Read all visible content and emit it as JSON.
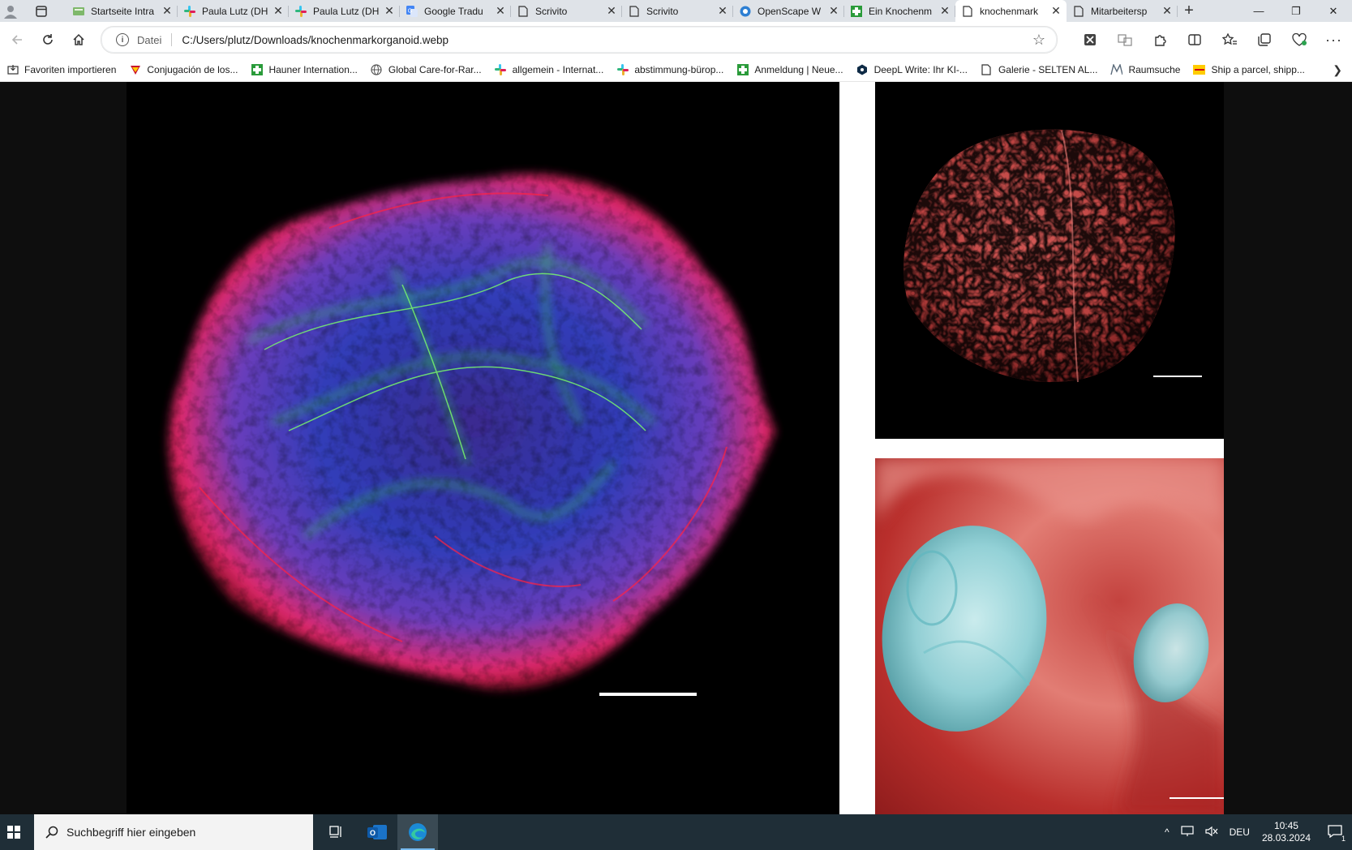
{
  "browser": {
    "tabs": [
      {
        "title": "Startseite Intra",
        "icon": "intranet-icon",
        "active": false
      },
      {
        "title": "Paula Lutz (DH",
        "icon": "slack-icon",
        "active": false
      },
      {
        "title": "Paula Lutz (DH",
        "icon": "slack-icon",
        "active": false
      },
      {
        "title": "Google Tradu",
        "icon": "google-translate-icon",
        "active": false
      },
      {
        "title": "Scrivito",
        "icon": "page-icon",
        "active": false
      },
      {
        "title": "Scrivito",
        "icon": "page-icon",
        "active": false
      },
      {
        "title": "OpenScape W",
        "icon": "openscape-icon",
        "active": false
      },
      {
        "title": "Ein Knochenm",
        "icon": "green-cross-icon",
        "active": false
      },
      {
        "title": "knochenmark",
        "icon": "page-icon",
        "active": true
      },
      {
        "title": "Mitarbeitersp",
        "icon": "page-icon",
        "active": false
      }
    ],
    "address": {
      "scheme_label": "Datei",
      "url": "C:/Users/plutz/Downloads/knochenmarkorganoid.webp"
    },
    "favorites": [
      {
        "label": "Favoriten importieren",
        "icon": "import-icon"
      },
      {
        "label": "Conjugación de los...",
        "icon": "flag-icon"
      },
      {
        "label": "Hauner Internation...",
        "icon": "green-cross-icon"
      },
      {
        "label": "Global Care-for-Rar...",
        "icon": "globe-icon"
      },
      {
        "label": "allgemein - Internat...",
        "icon": "slack-icon"
      },
      {
        "label": "abstimmung-bürop...",
        "icon": "slack-icon"
      },
      {
        "label": "Anmeldung | Neue...",
        "icon": "green-cross-icon"
      },
      {
        "label": "DeepL Write: Ihr KI-...",
        "icon": "deepl-icon"
      },
      {
        "label": "Galerie - SELTEN AL...",
        "icon": "page-icon"
      },
      {
        "label": "Raumsuche",
        "icon": "raumsuche-icon"
      },
      {
        "label": "Ship a parcel, shipp...",
        "icon": "dhl-icon"
      }
    ]
  },
  "taskbar": {
    "search_placeholder": "Suchbegriff hier eingeben",
    "language": "DEU",
    "time": "10:45",
    "date": "28.03.2024",
    "notification_count": "1"
  },
  "colors": {
    "tabstrip": "#dfe3e8",
    "taskbar": "#1f2e37",
    "edge_blue": "#1b8ad6"
  }
}
